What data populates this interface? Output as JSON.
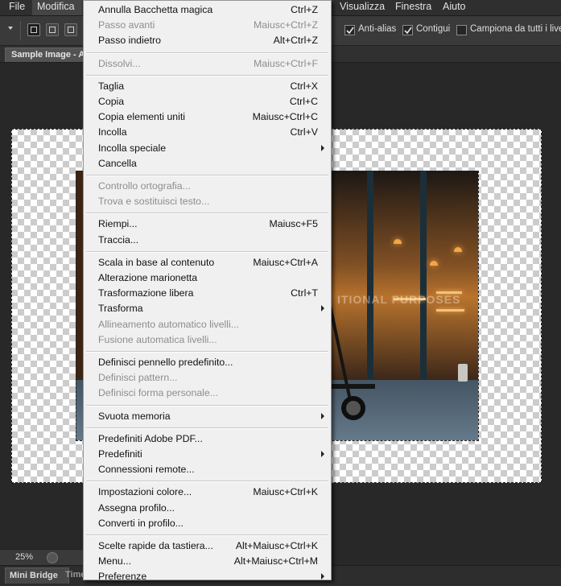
{
  "menubar": {
    "items": [
      {
        "label": "File",
        "active": false
      },
      {
        "label": "Modifica",
        "active": true
      },
      {
        "label": "Visualizza",
        "active": false
      },
      {
        "label": "Finestra",
        "active": false
      },
      {
        "label": "Aiuto",
        "active": false
      }
    ]
  },
  "options": {
    "antialias_label": "Anti-alias",
    "antialias_checked": true,
    "contigui_label": "Contigui",
    "contigui_checked": true,
    "campiona_label": "Campiona da tutti i livelli",
    "campiona_checked": false
  },
  "document": {
    "tab_title": "Sample Image - A",
    "watermark": "ITIONAL PURPOSES"
  },
  "status": {
    "zoom": "25%"
  },
  "bottom_tabs": [
    {
      "label": "Mini Bridge"
    },
    {
      "label": "Time"
    }
  ],
  "edit_menu": {
    "items": [
      {
        "label": "Annulla Bacchetta magica",
        "shortcut": "Ctrl+Z",
        "disabled": false,
        "submenu": false
      },
      {
        "label": "Passo avanti",
        "shortcut": "Maiusc+Ctrl+Z",
        "disabled": true,
        "submenu": false
      },
      {
        "label": "Passo indietro",
        "shortcut": "Alt+Ctrl+Z",
        "disabled": false,
        "submenu": false
      },
      {
        "separator": true
      },
      {
        "label": "Dissolvi...",
        "shortcut": "Maiusc+Ctrl+F",
        "disabled": true,
        "submenu": false
      },
      {
        "separator": true
      },
      {
        "label": "Taglia",
        "shortcut": "Ctrl+X",
        "disabled": false,
        "submenu": false
      },
      {
        "label": "Copia",
        "shortcut": "Ctrl+C",
        "disabled": false,
        "submenu": false
      },
      {
        "label": "Copia elementi uniti",
        "shortcut": "Maiusc+Ctrl+C",
        "disabled": false,
        "submenu": false
      },
      {
        "label": "Incolla",
        "shortcut": "Ctrl+V",
        "disabled": false,
        "submenu": false
      },
      {
        "label": "Incolla speciale",
        "shortcut": "",
        "disabled": false,
        "submenu": true
      },
      {
        "label": "Cancella",
        "shortcut": "",
        "disabled": false,
        "submenu": false
      },
      {
        "separator": true
      },
      {
        "label": "Controllo ortografia...",
        "shortcut": "",
        "disabled": true,
        "submenu": false
      },
      {
        "label": "Trova e sostituisci testo...",
        "shortcut": "",
        "disabled": true,
        "submenu": false
      },
      {
        "separator": true
      },
      {
        "label": "Riempi...",
        "shortcut": "Maiusc+F5",
        "disabled": false,
        "submenu": false
      },
      {
        "label": "Traccia...",
        "shortcut": "",
        "disabled": false,
        "submenu": false
      },
      {
        "separator": true
      },
      {
        "label": "Scala in base al contenuto",
        "shortcut": "Maiusc+Ctrl+A",
        "disabled": false,
        "submenu": false
      },
      {
        "label": "Alterazione marionetta",
        "shortcut": "",
        "disabled": false,
        "submenu": false
      },
      {
        "label": "Trasformazione libera",
        "shortcut": "Ctrl+T",
        "disabled": false,
        "submenu": false
      },
      {
        "label": "Trasforma",
        "shortcut": "",
        "disabled": false,
        "submenu": true
      },
      {
        "label": "Allineamento automatico livelli...",
        "shortcut": "",
        "disabled": true,
        "submenu": false
      },
      {
        "label": "Fusione automatica livelli...",
        "shortcut": "",
        "disabled": true,
        "submenu": false
      },
      {
        "separator": true
      },
      {
        "label": "Definisci pennello predefinito...",
        "shortcut": "",
        "disabled": false,
        "submenu": false
      },
      {
        "label": "Definisci pattern...",
        "shortcut": "",
        "disabled": true,
        "submenu": false
      },
      {
        "label": "Definisci forma personale...",
        "shortcut": "",
        "disabled": true,
        "submenu": false
      },
      {
        "separator": true
      },
      {
        "label": "Svuota memoria",
        "shortcut": "",
        "disabled": false,
        "submenu": true
      },
      {
        "separator": true
      },
      {
        "label": "Predefiniti Adobe PDF...",
        "shortcut": "",
        "disabled": false,
        "submenu": false
      },
      {
        "label": "Predefiniti",
        "shortcut": "",
        "disabled": false,
        "submenu": true
      },
      {
        "label": "Connessioni remote...",
        "shortcut": "",
        "disabled": false,
        "submenu": false
      },
      {
        "separator": true
      },
      {
        "label": "Impostazioni colore...",
        "shortcut": "Maiusc+Ctrl+K",
        "disabled": false,
        "submenu": false
      },
      {
        "label": "Assegna profilo...",
        "shortcut": "",
        "disabled": false,
        "submenu": false
      },
      {
        "label": "Converti in profilo...",
        "shortcut": "",
        "disabled": false,
        "submenu": false
      },
      {
        "separator": true
      },
      {
        "label": "Scelte rapide da tastiera...",
        "shortcut": "Alt+Maiusc+Ctrl+K",
        "disabled": false,
        "submenu": false
      },
      {
        "label": "Menu...",
        "shortcut": "Alt+Maiusc+Ctrl+M",
        "disabled": false,
        "submenu": false
      },
      {
        "label": "Preferenze",
        "shortcut": "",
        "disabled": false,
        "submenu": true
      }
    ]
  }
}
